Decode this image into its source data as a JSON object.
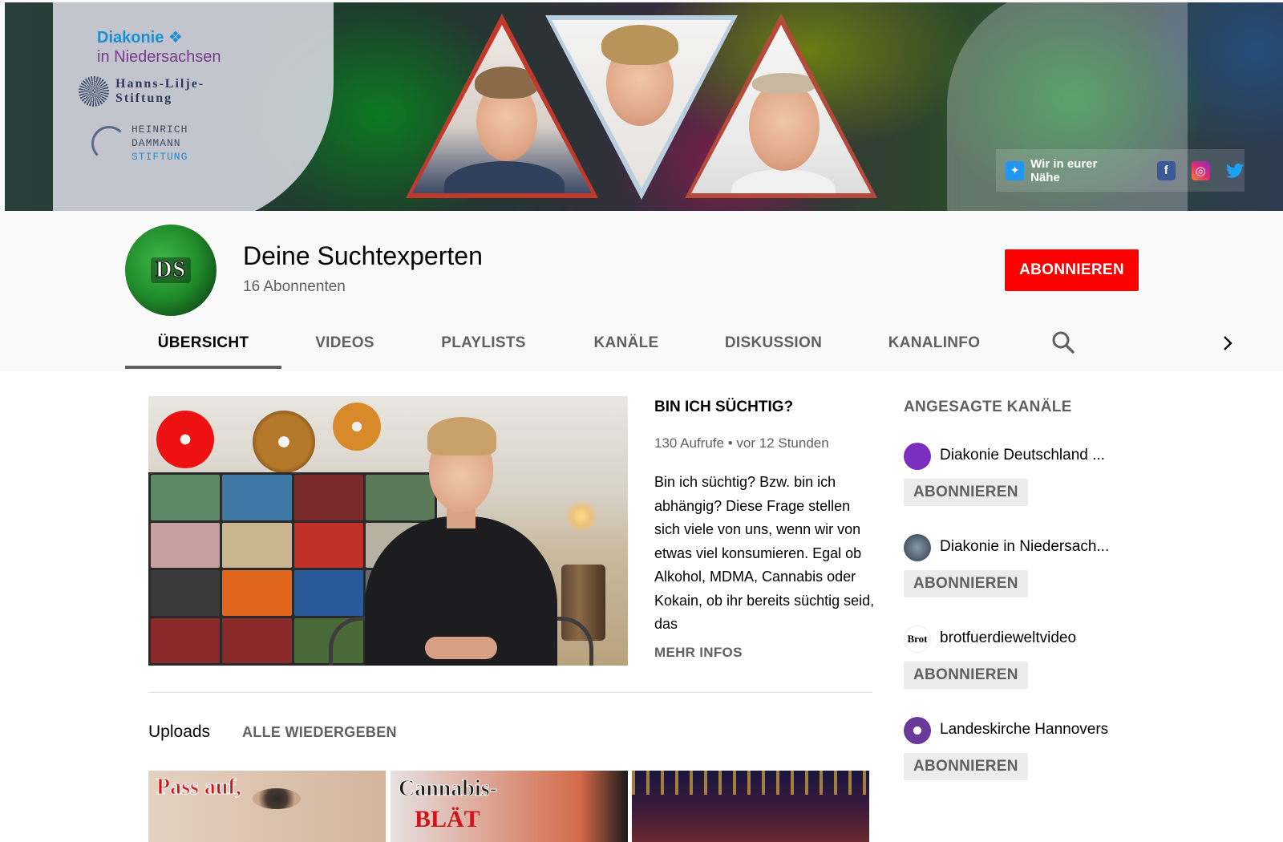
{
  "banner": {
    "logo_diakonie_line1": "Diakonie ❖",
    "logo_diakonie_line2": "in Niedersachsen",
    "logo_hanns_line1": "Hanns-Lilje-",
    "logo_hanns_line2": "Stiftung",
    "logo_heinrich_line1": "HEINRICH",
    "logo_heinrich_line2": "DAMMANN",
    "logo_heinrich_line3": "STIFTUNG",
    "link_label": "Wir in eurer Nähe"
  },
  "channel": {
    "title": "Deine Suchtexperten",
    "subscribers": "16 Abonnenten",
    "avatar_text": "DS",
    "subscribe_label": "ABONNIEREN"
  },
  "tabs": [
    {
      "label": "ÜBERSICHT",
      "active": true
    },
    {
      "label": "VIDEOS",
      "active": false
    },
    {
      "label": "PLAYLISTS",
      "active": false
    },
    {
      "label": "KANÄLE",
      "active": false
    },
    {
      "label": "DISKUSSION",
      "active": false
    },
    {
      "label": "KANALINFO",
      "active": false
    }
  ],
  "featured_video": {
    "title": "BIN ICH SÜCHTIG?",
    "views": "130 Aufrufe",
    "age": "vor 12 Stunden",
    "description": "Bin ich süchtig? Bzw. bin ich abhängig? Diese Frage stellen sich viele von uns, wenn wir von etwas viel konsumieren. Egal ob Alkohol, MDMA, Cannabis oder Kokain, ob ihr bereits süchtig seid, das",
    "more_label": "MEHR INFOS"
  },
  "uploads": {
    "title": "Uploads",
    "play_all_label": "ALLE WIEDERGEBEN",
    "thumbs": [
      {
        "text": "Pass auf,"
      },
      {
        "text": "Cannabis-",
        "text2": "BLÄT"
      },
      {
        "text": ""
      }
    ]
  },
  "featured_channels": {
    "title": "ANGESAGTE KANÄLE",
    "items": [
      {
        "name": "Diakonie Deutschland ...",
        "button": "ABONNIEREN",
        "color": "#7b2fbf"
      },
      {
        "name": "Diakonie in Niedersach...",
        "button": "ABONNIEREN",
        "color": "#3a4a5a"
      },
      {
        "name": "brotfuerdieweltvideo",
        "button": "ABONNIEREN",
        "color": "#ffffff"
      },
      {
        "name": "Landeskirche Hannovers",
        "button": "ABONNIEREN",
        "color": "#6a3a9a"
      }
    ]
  },
  "colors": {
    "subscribe_red": "#ff0000",
    "text_primary": "#030303",
    "text_secondary": "#606060"
  }
}
